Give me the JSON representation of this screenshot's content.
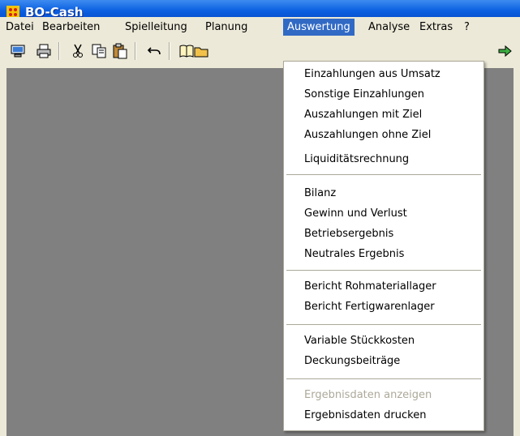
{
  "window": {
    "title": "BO-Cash"
  },
  "menubar": {
    "items": [
      "Datei",
      "Bearbeiten",
      "Spielleitung",
      "Planung",
      "Auswertung",
      "Analyse",
      "Extras",
      "?"
    ],
    "active": "Auswertung"
  },
  "toolbar": {
    "buttons": [
      "network-icon",
      "print-icon",
      "cut-icon",
      "copy-icon",
      "paste-icon",
      "undo-icon",
      "book-icon",
      "open-icon",
      "arrow-right-icon"
    ]
  },
  "dropdown": {
    "groups": [
      [
        "Einzahlungen aus Umsatz",
        "Sonstige Einzahlungen",
        "Auszahlungen mit Ziel",
        "Auszahlungen ohne Ziel",
        "Liquiditätsrechnung"
      ],
      [
        "Bilanz",
        "Gewinn und Verlust",
        "Betriebsergebnis",
        "Neutrales Ergebnis"
      ],
      [
        "Bericht Rohmateriallager",
        "Bericht Fertigwarenlager"
      ],
      [
        "Variable Stückkosten",
        "Deckungsbeiträge"
      ],
      [
        "Ergebnisdaten anzeigen",
        "Ergebnisdaten drucken"
      ]
    ],
    "disabled": [
      "Ergebnisdaten anzeigen"
    ]
  },
  "colors": {
    "titlebar": "#0a5fe0",
    "menu_highlight": "#316ac5",
    "workspace": "#808080",
    "chrome": "#ece9d8",
    "disabled_text": "#aca899"
  }
}
